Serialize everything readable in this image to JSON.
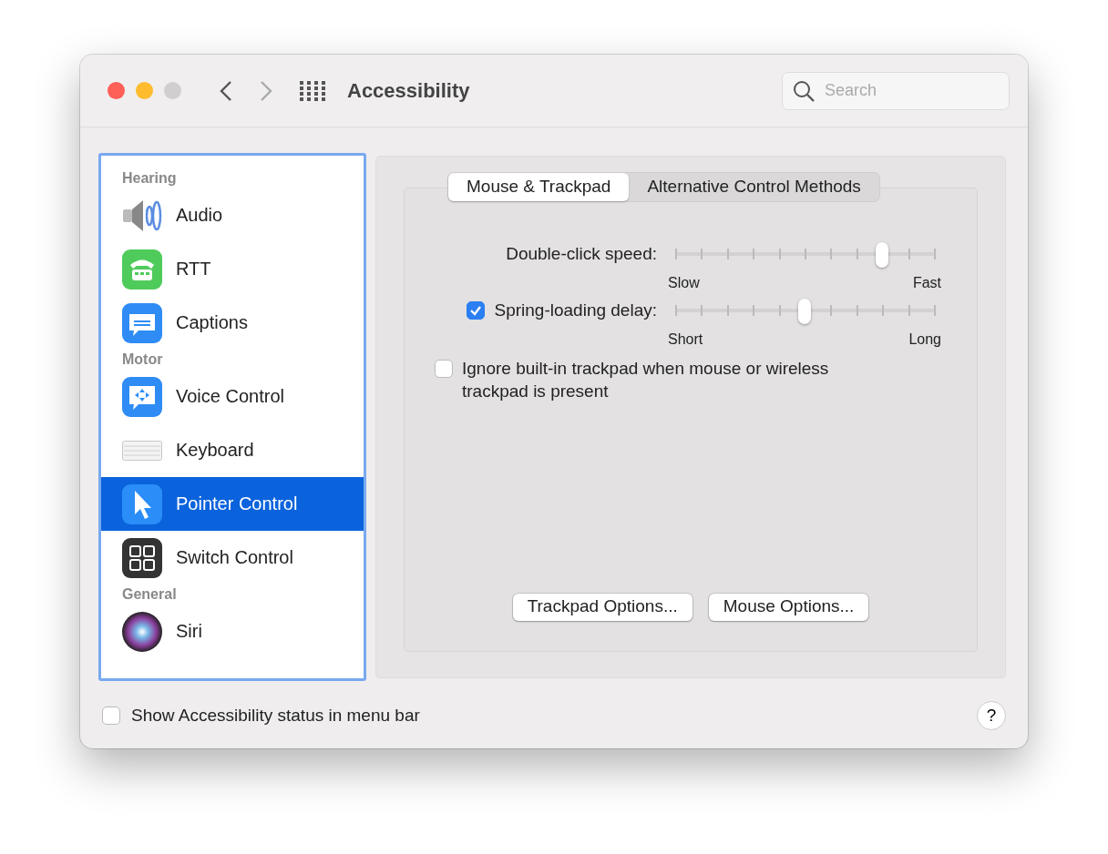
{
  "window": {
    "title": "Accessibility"
  },
  "search": {
    "placeholder": "Search"
  },
  "sidebar": {
    "groups": [
      {
        "header": "Hearing",
        "items": [
          {
            "label": "Audio",
            "kind": "speaker",
            "selected": false
          },
          {
            "label": "RTT",
            "kind": "phone",
            "selected": false
          },
          {
            "label": "Captions",
            "kind": "captions",
            "selected": false
          }
        ]
      },
      {
        "header": "Motor",
        "items": [
          {
            "label": "Voice Control",
            "kind": "voice",
            "selected": false
          },
          {
            "label": "Keyboard",
            "kind": "keyboard",
            "selected": false
          },
          {
            "label": "Pointer Control",
            "kind": "pointer",
            "selected": true
          },
          {
            "label": "Switch Control",
            "kind": "switch",
            "selected": false
          }
        ]
      },
      {
        "header": "General",
        "items": [
          {
            "label": "Siri",
            "kind": "siri",
            "selected": false
          }
        ]
      }
    ]
  },
  "tabs": [
    {
      "label": "Mouse & Trackpad",
      "selected": true
    },
    {
      "label": "Alternative Control Methods",
      "selected": false
    }
  ],
  "settings": [
    {
      "kind": "slider",
      "label": "Double-click speed:",
      "level": 0.8,
      "min_label": "Slow",
      "max_label": "Fast"
    },
    {
      "kind": "slider",
      "label": "Spring-loading delay:",
      "checked": true,
      "level": 0.5,
      "min_label": "Short",
      "max_label": "Long"
    },
    {
      "kind": "checkbox",
      "label": "Ignore built-in trackpad when mouse or wireless trackpad is present",
      "checked": false
    }
  ],
  "buttons": [
    "Trackpad Options...",
    "Mouse Options..."
  ],
  "footer": {
    "label": "Show Accessibility status in menu bar",
    "checked": false,
    "help": "?"
  }
}
